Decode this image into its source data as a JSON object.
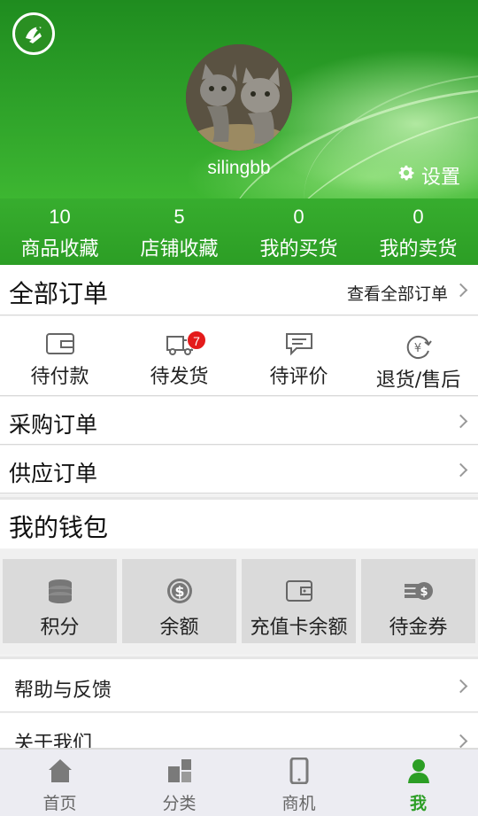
{
  "header": {
    "username": "silingbb",
    "settings_label": "设置"
  },
  "stats": [
    {
      "count": "10",
      "label": "商品收藏"
    },
    {
      "count": "5",
      "label": "店铺收藏"
    },
    {
      "count": "0",
      "label": "我的买货"
    },
    {
      "count": "0",
      "label": "我的卖货"
    }
  ],
  "orders": {
    "title": "全部订单",
    "view_all": "查看全部订单",
    "status": [
      {
        "label": "待付款",
        "icon": "wallet-card-icon"
      },
      {
        "label": "待发货",
        "icon": "truck-icon",
        "badge": "7"
      },
      {
        "label": "待评价",
        "icon": "comment-icon"
      },
      {
        "label": "退货/售后",
        "icon": "yen-return-icon"
      }
    ]
  },
  "rows": {
    "purchase_orders": "采购订单",
    "supply_orders": "供应订单"
  },
  "wallet": {
    "title": "我的钱包",
    "tiles": [
      {
        "label": "积分",
        "icon": "coin-stack-icon"
      },
      {
        "label": "余额",
        "icon": "dollar-coin-icon"
      },
      {
        "label": "充值卡余额",
        "icon": "card-wallet-icon"
      },
      {
        "label": "待金券",
        "icon": "coupon-coins-icon"
      }
    ]
  },
  "links": {
    "help": "帮助与反馈",
    "about": "关于我们"
  },
  "bottom_nav": [
    {
      "label": "首页",
      "icon": "home-icon"
    },
    {
      "label": "分类",
      "icon": "category-icon"
    },
    {
      "label": "商机",
      "icon": "phone-icon"
    },
    {
      "label": "我",
      "icon": "person-icon",
      "active": true
    }
  ],
  "colors": {
    "brand_green": "#2c9e25",
    "badge_red": "#e41b1b"
  }
}
